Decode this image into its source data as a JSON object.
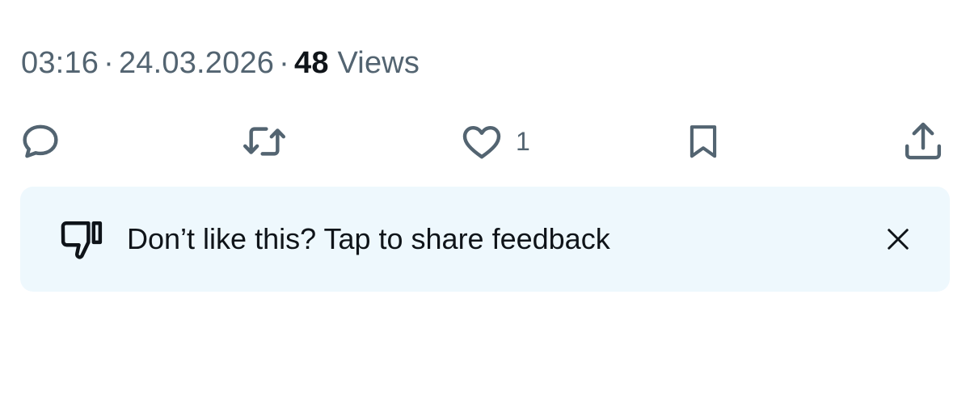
{
  "post_meta": {
    "time": "03:16",
    "separator": "·",
    "date": "24.03.2026",
    "views_count": "48",
    "views_label": "Views"
  },
  "actions": {
    "reply": {
      "icon": "reply-icon"
    },
    "repost": {
      "icon": "repost-icon"
    },
    "like": {
      "icon": "heart-icon",
      "count": "1"
    },
    "bookmark": {
      "icon": "bookmark-icon"
    },
    "share": {
      "icon": "share-icon"
    }
  },
  "feedback_banner": {
    "icon": "thumbs-down-icon",
    "text": "Don’t like this? Tap to share feedback",
    "close_icon": "close-icon",
    "background": "#eef8fd"
  },
  "colors": {
    "secondary_text": "#536471",
    "primary_text": "#0f1419"
  }
}
